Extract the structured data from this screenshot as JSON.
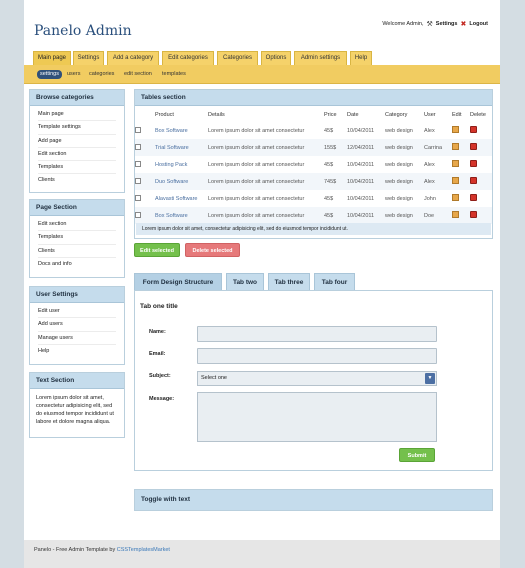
{
  "app": {
    "logo": "Panelo Admin",
    "welcome": "Welcome Admin,",
    "settings_link": "Settings",
    "logout_link": "Logout"
  },
  "nav": {
    "tabs": [
      "Main page",
      "Settings",
      "Add a category",
      "Edit categories",
      "Categories",
      "Options",
      "Admin settings",
      "Help"
    ],
    "active_tab": "Main page",
    "subtabs": [
      "settings",
      "users",
      "categories",
      "edit section",
      "templates"
    ],
    "active_subtab": "settings"
  },
  "sidebar": {
    "browse": {
      "title": "Browse categories",
      "items": [
        "Main page",
        "Template settings",
        "Add page",
        "Edit section",
        "Templates",
        "Clients"
      ]
    },
    "page_section": {
      "title": "Page Section",
      "items": [
        "Edit section",
        "Templates",
        "Clients",
        "Docs and info"
      ]
    },
    "user_settings": {
      "title": "User Settings",
      "items": [
        "Edit user",
        "Add users",
        "Manage users",
        "Help"
      ]
    },
    "text_section": {
      "title": "Text Section",
      "body": "Lorem ipsum dolor sit amet, consectetur adipisicing elit, sed do eiusmod tempor incididunt ut labore et dolore magna aliqua."
    }
  },
  "tables": {
    "title": "Tables section",
    "headers": [
      "Product",
      "Details",
      "Price",
      "Date",
      "Category",
      "User",
      "Edit",
      "Delete"
    ],
    "rows": [
      [
        "Box Software",
        "Lorem ipsum dolor sit amet consectetur",
        "45$",
        "10/04/2011",
        "web design",
        "Alex"
      ],
      [
        "Trial Software",
        "Lorem ipsum dolor sit amet consectetur",
        "155$",
        "12/04/2011",
        "web design",
        "Carrina"
      ],
      [
        "Hosting Pack",
        "Lorem ipsum dolor sit amet consectetur",
        "45$",
        "10/04/2011",
        "web design",
        "Alex"
      ],
      [
        "Duo Software",
        "Lorem ipsum dolor sit amet consectetur",
        "745$",
        "10/04/2011",
        "web design",
        "Alex"
      ],
      [
        "Alavasti Software",
        "Lorem ipsum dolor sit amet consectetur",
        "45$",
        "10/04/2011",
        "web design",
        "John"
      ],
      [
        "Box Software",
        "Lorem ipsum dolor sit amet consectetur",
        "45$",
        "10/04/2011",
        "web design",
        "Doe"
      ]
    ],
    "footer_text": "Lorem ipsum dolor sit amet, consectetur adipisicing elit, sed do eiusmod tempor incididunt ut.",
    "edit_button": "Edit selected",
    "delete_button": "Delete selected"
  },
  "form": {
    "tabs": [
      "Form Design Structure",
      "Tab two",
      "Tab three",
      "Tab four"
    ],
    "title": "Tab one title",
    "name_label": "Name:",
    "email_label": "Email:",
    "subject_label": "Subject:",
    "subject_value": "Select one",
    "message_label": "Message:",
    "submit": "Submit"
  },
  "toggle": {
    "title": "Toggle with text"
  },
  "footer": {
    "text": "Panelo - Free Admin Template by ",
    "link": "CSSTemplatesMarket"
  },
  "colors": {
    "accent": "#f1cc61",
    "header_blue": "#c5dcec",
    "logo_blue": "#2a4f7c",
    "active_sub": "#30507a"
  }
}
